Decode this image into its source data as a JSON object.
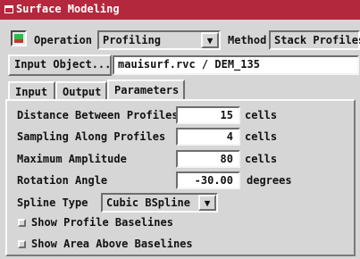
{
  "window": {
    "title": "Surface Modeling"
  },
  "toolbar": {
    "operation_label": "Operation",
    "operation_value": "Profiling",
    "method_label": "Method",
    "method_value": "Stack Profiles",
    "input_object_button": "Input Object...",
    "input_object_path": "mauisurf.rvc / DEM_135"
  },
  "tabs": [
    {
      "label": "Input",
      "active": false
    },
    {
      "label": "Output",
      "active": false
    },
    {
      "label": "Parameters",
      "active": true
    }
  ],
  "parameters": {
    "distance": {
      "label": "Distance Between Profiles",
      "value": "15",
      "unit": "cells"
    },
    "sampling": {
      "label": "Sampling Along Profiles",
      "value": "4",
      "unit": "cells"
    },
    "amplitude": {
      "label": "Maximum Amplitude",
      "value": "80",
      "unit": "cells"
    },
    "rotation": {
      "label": "Rotation Angle",
      "value": "-30.00",
      "unit": "degrees"
    },
    "spline": {
      "label": "Spline Type",
      "value": "Cubic BSpline"
    },
    "show_baselines": {
      "label": "Show Profile Baselines",
      "checked": false
    },
    "show_area": {
      "label": "Show Area Above Baselines",
      "checked": false
    }
  },
  "colors": {
    "titlebar": "#b4283d",
    "background": "#d6d6d6"
  }
}
